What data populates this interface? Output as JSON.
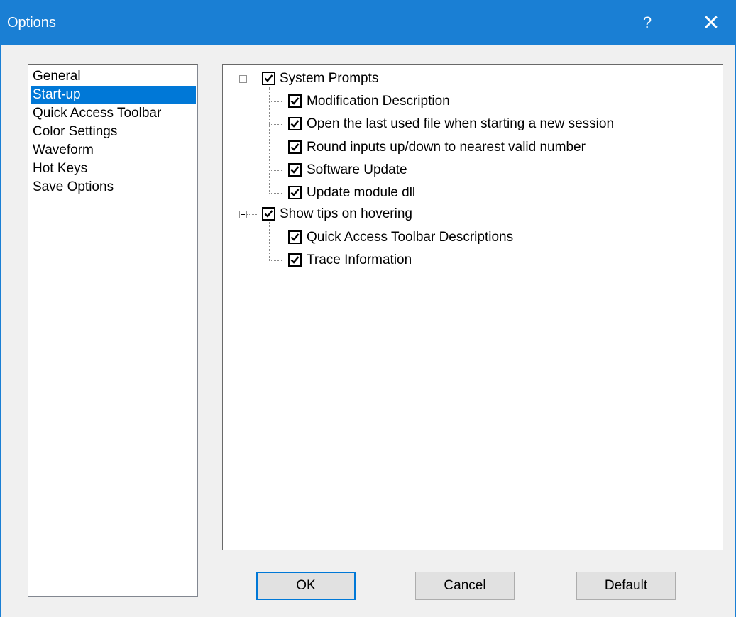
{
  "window": {
    "title": "Options",
    "help_label": "?",
    "close_label": "✕"
  },
  "categories": [
    {
      "label": "General",
      "selected": false
    },
    {
      "label": "Start-up",
      "selected": true
    },
    {
      "label": "Quick Access Toolbar",
      "selected": false
    },
    {
      "label": "Color Settings",
      "selected": false
    },
    {
      "label": "Waveform",
      "selected": false
    },
    {
      "label": "Hot Keys",
      "selected": false
    },
    {
      "label": "Save Options",
      "selected": false
    }
  ],
  "tree": {
    "groups": [
      {
        "label": "System Prompts",
        "checked": true,
        "expanded": true,
        "children": [
          {
            "label": "Modification Description",
            "checked": true
          },
          {
            "label": "Open the last used file when starting a new session",
            "checked": true
          },
          {
            "label": "Round inputs up/down to nearest valid number",
            "checked": true
          },
          {
            "label": "Software Update",
            "checked": true
          },
          {
            "label": "Update module dll",
            "checked": true
          }
        ]
      },
      {
        "label": "Show tips on hovering",
        "checked": true,
        "expanded": true,
        "children": [
          {
            "label": "Quick Access Toolbar Descriptions",
            "checked": true
          },
          {
            "label": "Trace Information",
            "checked": true
          }
        ]
      }
    ]
  },
  "buttons": {
    "ok": "OK",
    "cancel": "Cancel",
    "default": "Default"
  },
  "colors": {
    "titlebar": "#1a7fd4",
    "selection": "#0078d7"
  }
}
